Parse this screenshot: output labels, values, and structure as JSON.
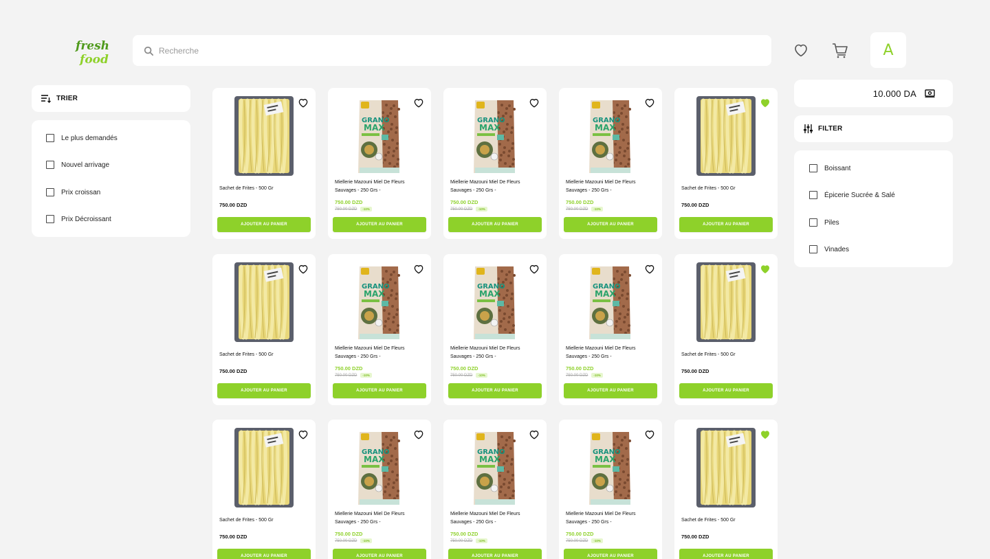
{
  "brand": {
    "line1": "fresh",
    "line2": "food",
    "color": "#8ed12a"
  },
  "search": {
    "placeholder": "Recherche"
  },
  "header": {
    "avatar_letter": "A",
    "icons": [
      "heart-icon",
      "cart-icon"
    ]
  },
  "sort": {
    "title": "TRIER",
    "options": [
      "Le plus demandés",
      "Nouvel arrivage",
      "Prix croissan",
      "Prix Décroissant"
    ]
  },
  "balance": {
    "amount": "10.000 DA"
  },
  "filter": {
    "title": "FILTER",
    "options": [
      "Boissant",
      "Épicerie Sucrée & Salé",
      "Piles",
      "Vinades"
    ]
  },
  "button_label": "AJOUTER AU PANIER",
  "products": [
    {
      "type": "fries",
      "name": "Sachet de Frites - 500 Gr",
      "price": "750.00 DZD",
      "favorite": false
    },
    {
      "type": "grano",
      "name": "Miellerie Mazouni Miel De Fleurs Sauvages - 250 Grs -",
      "price": "750.00 DZD",
      "old_price": "750.00 DZD",
      "discount": "-10%",
      "favorite": false
    },
    {
      "type": "grano",
      "name": "Miellerie Mazouni Miel De Fleurs Sauvages - 250 Grs -",
      "price": "750.00 DZD",
      "old_price": "750.00 DZD",
      "discount": "-10%",
      "favorite": false
    },
    {
      "type": "grano",
      "name": "Miellerie Mazouni Miel De Fleurs Sauvages - 250 Grs -",
      "price": "750.00 DZD",
      "old_price": "750.00 DZD",
      "discount": "-10%",
      "favorite": false
    },
    {
      "type": "fries",
      "name": "Sachet de Frites - 500 Gr",
      "price": "750.00 DZD",
      "favorite": true
    },
    {
      "type": "fries",
      "name": "Sachet de Frites - 500 Gr",
      "price": "750.00 DZD",
      "favorite": false
    },
    {
      "type": "grano",
      "name": "Miellerie Mazouni Miel De Fleurs Sauvages - 250 Grs -",
      "price": "750.00 DZD",
      "old_price": "750.00 DZD",
      "discount": "-10%",
      "favorite": false
    },
    {
      "type": "grano",
      "name": "Miellerie Mazouni Miel De Fleurs Sauvages - 250 Grs -",
      "price": "750.00 DZD",
      "old_price": "750.00 DZD",
      "discount": "-10%",
      "favorite": false
    },
    {
      "type": "grano",
      "name": "Miellerie Mazouni Miel De Fleurs Sauvages - 250 Grs -",
      "price": "750.00 DZD",
      "old_price": "750.00 DZD",
      "discount": "-10%",
      "favorite": false
    },
    {
      "type": "fries",
      "name": "Sachet de Frites - 500 Gr",
      "price": "750.00 DZD",
      "favorite": true
    },
    {
      "type": "fries",
      "name": "Sachet de Frites - 500 Gr",
      "price": "750.00 DZD",
      "favorite": false
    },
    {
      "type": "grano",
      "name": "Miellerie Mazouni Miel De Fleurs Sauvages - 250 Grs -",
      "price": "750.00 DZD",
      "old_price": "750.00 DZD",
      "discount": "-10%",
      "favorite": false
    },
    {
      "type": "grano",
      "name": "Miellerie Mazouni Miel De Fleurs Sauvages - 250 Grs -",
      "price": "750.00 DZD",
      "old_price": "750.00 DZD",
      "discount": "-10%",
      "favorite": false
    },
    {
      "type": "grano",
      "name": "Miellerie Mazouni Miel De Fleurs Sauvages - 250 Grs -",
      "price": "750.00 DZD",
      "old_price": "750.00 DZD",
      "discount": "-10%",
      "favorite": false
    },
    {
      "type": "fries",
      "name": "Sachet de Frites - 500 Gr",
      "price": "750.00 DZD",
      "favorite": true
    }
  ],
  "colors": {
    "accent": "#8ed12a",
    "background": "#f3f3f3",
    "card": "#ffffff"
  }
}
